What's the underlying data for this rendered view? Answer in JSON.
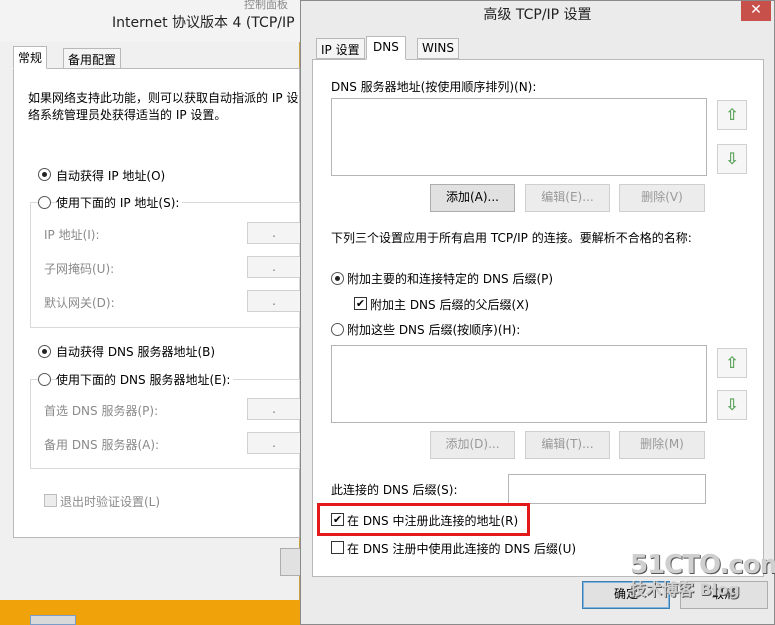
{
  "bg_window": {
    "title": "Internet 协议版本 4 (TCP/IP",
    "taskbar_fragment": "控制面板",
    "tabs": [
      "常规",
      "备用配置"
    ],
    "desc_line1": "如果网络支持此功能，则可以获取自动指派的 IP 设",
    "desc_line2": "络系统管理员处获得适当的 IP 设置。",
    "auto_ip": "自动获得 IP 地址(O)",
    "use_ip": "使用下面的 IP 地址(S):",
    "ip_label": "IP 地址(I):",
    "mask_label": "子网掩码(U):",
    "gw_label": "默认网关(D):",
    "auto_dns": "自动获得 DNS 服务器地址(B)",
    "use_dns": "使用下面的 DNS 服务器地址(E):",
    "pref_dns": "首选 DNS 服务器(P):",
    "alt_dns": "备用 DNS 服务器(A):",
    "validate": "退出时验证设置(L)",
    "dot": "."
  },
  "dialog": {
    "title": "高级 TCP/IP 设置",
    "close": "✕",
    "tabs": [
      "IP 设置",
      "DNS",
      "WINS"
    ],
    "dns_servers_label": "DNS 服务器地址(按使用顺序排列)(N):",
    "add": "添加(A)...",
    "edit": "编辑(E)...",
    "delete": "删除(V)",
    "suffix_desc": "下列三个设置应用于所有启用 TCP/IP 的连接。要解析不合格的名称:",
    "append_primary": "附加主要的和连接特定的 DNS 后缀(P)",
    "append_parent": "附加主 DNS 后缀的父后缀(X)",
    "append_these": "附加这些 DNS 后缀(按顺序)(H):",
    "add2": "添加(D)...",
    "edit2": "编辑(T)...",
    "delete2": "删除(M)",
    "conn_suffix_label": "此连接的 DNS 后缀(S):",
    "register": "在 DNS 中注册此连接的地址(R)",
    "use_suffix_register": "在 DNS 注册中使用此连接的 DNS 后缀(U)",
    "ok": "确定",
    "cancel": "取消",
    "check": "✔",
    "up": "⇧",
    "down": "⇩"
  },
  "watermark": {
    "line1": "51CTO.com",
    "line2": "技术博客 Blog"
  },
  "colors": {
    "desktop": "#f0a20a",
    "highlight": "#e21a1a",
    "close": "#c7504a"
  }
}
